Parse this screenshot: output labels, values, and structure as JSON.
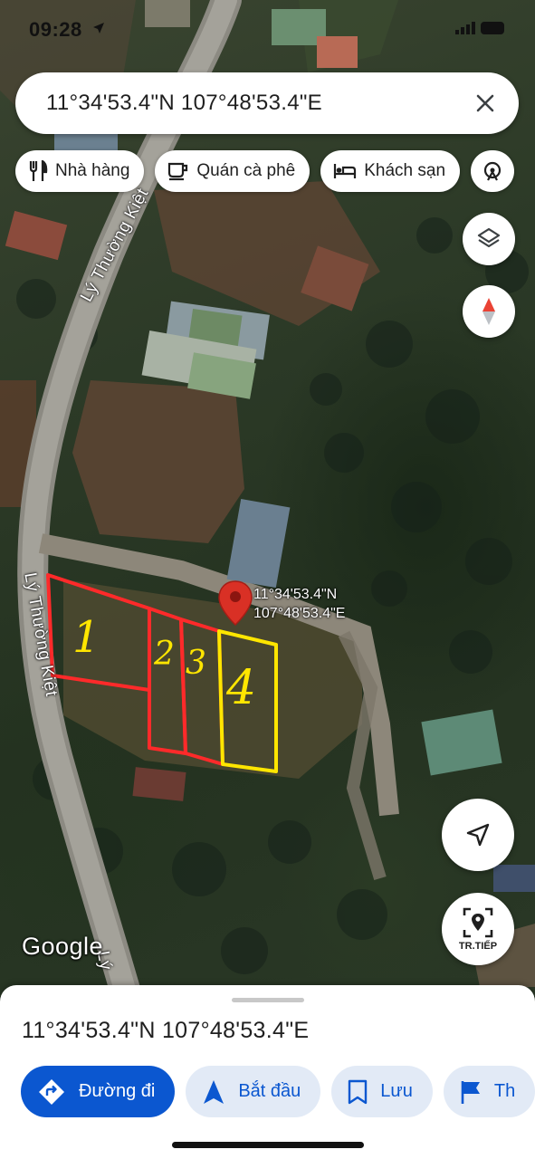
{
  "status_bar": {
    "time": "09:28"
  },
  "search": {
    "query": "11°34'53.4\"N 107°48'53.4\"E"
  },
  "chips": [
    {
      "label": "Nhà hàng",
      "icon": "restaurant-icon"
    },
    {
      "label": "Quán cà phê",
      "icon": "coffee-icon"
    },
    {
      "label": "Khách sạn",
      "icon": "hotel-icon"
    },
    {
      "label": "",
      "icon": "attractions-icon"
    }
  ],
  "map": {
    "road_labels": [
      "Lý Thường Kiệt",
      "Lý Thường Kiệt",
      "Lý"
    ],
    "pin_label_line1": "11°34'53.4\"N",
    "pin_label_line2": "107°48'53.4\"E",
    "plot_numbers": [
      "1",
      "2",
      "3",
      "4"
    ],
    "plot_colors": {
      "plots_1_3": "#ff2a2a",
      "plot_4": "#ffe600"
    },
    "pin_color": "#d93025",
    "attribution": "Google"
  },
  "buttons": {
    "layers": "layers-icon",
    "compass": "compass-icon",
    "my_location": "my-location-icon",
    "next_label": "TR.TIẾP"
  },
  "sheet": {
    "title": "11°34'53.4\"N 107°48'53.4\"E",
    "actions": [
      {
        "label": "Đường đi",
        "icon": "directions-icon"
      },
      {
        "label": "Bắt đầu",
        "icon": "navigation-arrow-icon"
      },
      {
        "label": "Lưu",
        "icon": "bookmark-icon"
      },
      {
        "label": "Th",
        "icon": "flag-icon"
      }
    ]
  }
}
